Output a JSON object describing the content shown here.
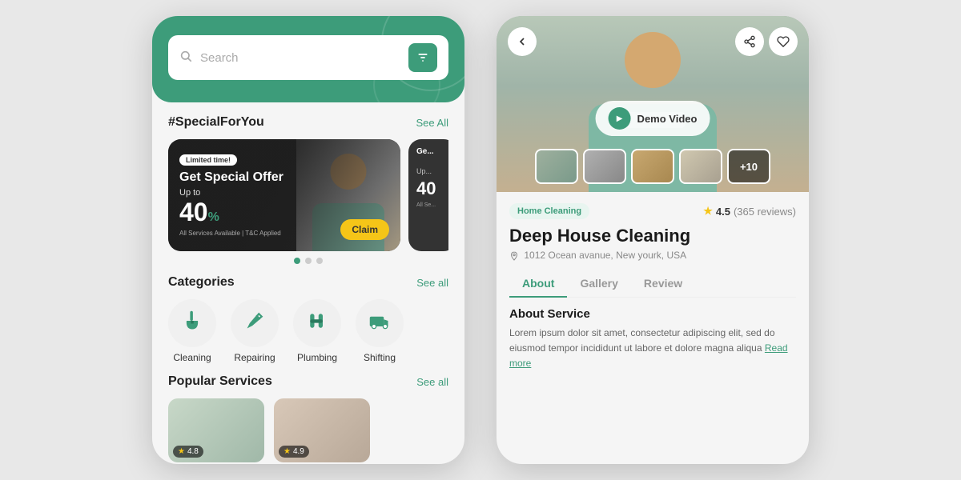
{
  "left_phone": {
    "search": {
      "placeholder": "Search",
      "filter_icon": "sliders-icon"
    },
    "special_section": {
      "title": "#SpecialForYou",
      "see_all": "See All",
      "promo_card": {
        "badge": "Limited time!",
        "title": "Get Special Offer",
        "up_to_label": "Up to",
        "discount": "40",
        "percent_symbol": "%",
        "small_text": "All Services Available | T&C Applied",
        "claim_label": "Claim"
      }
    },
    "categories_section": {
      "title": "Categories",
      "see_all": "See all",
      "items": [
        {
          "label": "Cleaning",
          "icon": "broom-icon"
        },
        {
          "label": "Repairing",
          "icon": "wrench-icon"
        },
        {
          "label": "Plumbing",
          "icon": "pipe-icon"
        },
        {
          "label": "Shifting",
          "icon": "truck-icon"
        }
      ]
    },
    "popular_section": {
      "title": "Popular Services",
      "see_all": "See all",
      "services": [
        {
          "rating": "4.8"
        },
        {
          "rating": "4.9"
        }
      ]
    }
  },
  "right_phone": {
    "back_icon": "arrow-left-icon",
    "share_icon": "share-icon",
    "favorite_icon": "heart-icon",
    "demo_video": {
      "label": "Demo Video",
      "play_icon": "play-icon"
    },
    "thumbnail_more": "+10",
    "category_tag": "Home Cleaning",
    "rating": {
      "value": "4.5",
      "reviews": "(365 reviews)"
    },
    "title": "Deep House Cleaning",
    "address": "1012 Ocean avanue, New yourk, USA",
    "tabs": [
      {
        "label": "About",
        "active": true
      },
      {
        "label": "Gallery",
        "active": false
      },
      {
        "label": "Review",
        "active": false
      }
    ],
    "about": {
      "title": "About Service",
      "text": "Lorem ipsum dolor sit amet, consectetur adipiscing elit, sed do eiusmod tempor incididunt ut labore et dolore magna aliqua ",
      "read_more": "Read more"
    }
  }
}
